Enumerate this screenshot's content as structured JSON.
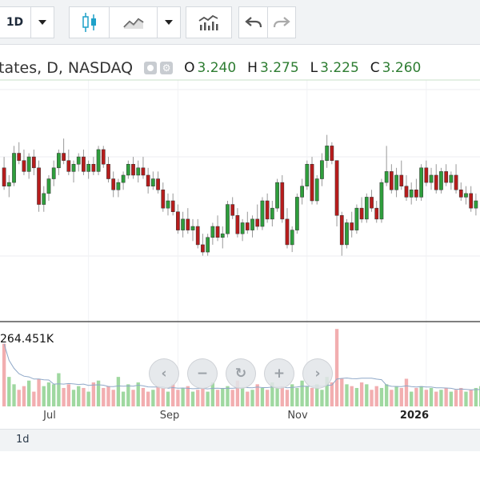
{
  "toolbar": {
    "interval_label": "1D",
    "icons": [
      "dropdown-arrow-icon",
      "candlestick-icon",
      "line-chart-icon",
      "dropdown-arrow-icon",
      "indicators-icon",
      "undo-icon",
      "redo-icon"
    ]
  },
  "legend": {
    "title": "tates, D, NASDAQ",
    "open_label": "O",
    "open": "3.240",
    "high_label": "H",
    "high": "3.275",
    "low_label": "L",
    "low": "3.225",
    "close_label": "C",
    "close": "3.260"
  },
  "volume": {
    "label": "264.451K"
  },
  "x_axis": {
    "labels": [
      {
        "text": "Jul",
        "bold": false
      },
      {
        "text": "Sep",
        "bold": false
      },
      {
        "text": "Nov",
        "bold": false
      },
      {
        "text": "2026",
        "bold": true
      }
    ]
  },
  "bottom": {
    "period": "1d"
  },
  "nav": {
    "icons": [
      "scroll-left-icon",
      "zoom-out-icon",
      "reset-icon",
      "zoom-in-icon",
      "scroll-right-icon"
    ],
    "glyphs": [
      "‹",
      "−",
      "↻",
      "+",
      "›"
    ]
  },
  "colors": {
    "up": "#2e9e3c",
    "down": "#b71c1c",
    "vol_up": "#9fd8a0",
    "vol_down": "#f2aeb0",
    "ma": "#8fa8c8"
  },
  "chart_data": {
    "type": "candlestick",
    "candles": [
      [
        3.24,
        3.27,
        3.18,
        3.19
      ],
      [
        3.19,
        3.22,
        3.16,
        3.2
      ],
      [
        3.2,
        3.3,
        3.19,
        3.28
      ],
      [
        3.28,
        3.31,
        3.25,
        3.26
      ],
      [
        3.26,
        3.29,
        3.22,
        3.23
      ],
      [
        3.23,
        3.28,
        3.21,
        3.27
      ],
      [
        3.27,
        3.29,
        3.22,
        3.24
      ],
      [
        3.24,
        3.26,
        3.12,
        3.14
      ],
      [
        3.14,
        3.19,
        3.12,
        3.17
      ],
      [
        3.17,
        3.22,
        3.15,
        3.21
      ],
      [
        3.21,
        3.26,
        3.19,
        3.24
      ],
      [
        3.24,
        3.29,
        3.22,
        3.28
      ],
      [
        3.28,
        3.32,
        3.25,
        3.26
      ],
      [
        3.26,
        3.29,
        3.22,
        3.23
      ],
      [
        3.23,
        3.26,
        3.2,
        3.25
      ],
      [
        3.25,
        3.28,
        3.23,
        3.27
      ],
      [
        3.27,
        3.29,
        3.22,
        3.23
      ],
      [
        3.23,
        3.26,
        3.21,
        3.25
      ],
      [
        3.25,
        3.27,
        3.22,
        3.23
      ],
      [
        3.23,
        3.3,
        3.22,
        3.29
      ],
      [
        3.29,
        3.3,
        3.24,
        3.25
      ],
      [
        3.25,
        3.27,
        3.2,
        3.21
      ],
      [
        3.21,
        3.23,
        3.16,
        3.18
      ],
      [
        3.18,
        3.21,
        3.16,
        3.2
      ],
      [
        3.2,
        3.23,
        3.18,
        3.22
      ],
      [
        3.22,
        3.26,
        3.21,
        3.25
      ],
      [
        3.25,
        3.27,
        3.21,
        3.22
      ],
      [
        3.22,
        3.26,
        3.2,
        3.24
      ],
      [
        3.24,
        3.27,
        3.21,
        3.22
      ],
      [
        3.22,
        3.24,
        3.17,
        3.19
      ],
      [
        3.19,
        3.23,
        3.18,
        3.21
      ],
      [
        3.21,
        3.23,
        3.17,
        3.18
      ],
      [
        3.18,
        3.2,
        3.12,
        3.13
      ],
      [
        3.13,
        3.17,
        3.11,
        3.15
      ],
      [
        3.15,
        3.17,
        3.11,
        3.12
      ],
      [
        3.12,
        3.14,
        3.06,
        3.07
      ],
      [
        3.07,
        3.12,
        3.05,
        3.1
      ],
      [
        3.1,
        3.13,
        3.06,
        3.07
      ],
      [
        3.07,
        3.1,
        3.04,
        3.08
      ],
      [
        3.08,
        3.1,
        3.02,
        3.03
      ],
      [
        3.03,
        3.06,
        3.0,
        3.01
      ],
      [
        3.01,
        3.06,
        3.0,
        3.05
      ],
      [
        3.05,
        3.09,
        3.03,
        3.08
      ],
      [
        3.08,
        3.11,
        3.04,
        3.05
      ],
      [
        3.05,
        3.08,
        3.02,
        3.06
      ],
      [
        3.06,
        3.15,
        3.05,
        3.14
      ],
      [
        3.14,
        3.16,
        3.1,
        3.11
      ],
      [
        3.11,
        3.13,
        3.05,
        3.06
      ],
      [
        3.06,
        3.1,
        3.04,
        3.09
      ],
      [
        3.09,
        3.12,
        3.06,
        3.07
      ],
      [
        3.07,
        3.11,
        3.05,
        3.1
      ],
      [
        3.1,
        3.14,
        3.07,
        3.08
      ],
      [
        3.08,
        3.16,
        3.07,
        3.15
      ],
      [
        3.15,
        3.17,
        3.09,
        3.1
      ],
      [
        3.1,
        3.15,
        3.08,
        3.13
      ],
      [
        3.13,
        3.21,
        3.12,
        3.2
      ],
      [
        3.2,
        3.22,
        3.09,
        3.1
      ],
      [
        3.1,
        3.13,
        3.02,
        3.03
      ],
      [
        3.03,
        3.08,
        3.01,
        3.07
      ],
      [
        3.07,
        3.17,
        3.06,
        3.16
      ],
      [
        3.16,
        3.21,
        3.14,
        3.19
      ],
      [
        3.19,
        3.26,
        3.18,
        3.25
      ],
      [
        3.25,
        3.27,
        3.14,
        3.15
      ],
      [
        3.15,
        3.22,
        3.14,
        3.21
      ],
      [
        3.21,
        3.28,
        3.19,
        3.26
      ],
      [
        3.26,
        3.33,
        3.24,
        3.3
      ],
      [
        3.3,
        3.31,
        3.25,
        3.26
      ],
      [
        3.26,
        3.2,
        3.08,
        3.11
      ],
      [
        3.11,
        3.12,
        3.0,
        3.03
      ],
      [
        3.03,
        3.1,
        3.02,
        3.09
      ],
      [
        3.09,
        3.12,
        3.05,
        3.07
      ],
      [
        3.07,
        3.14,
        3.06,
        3.13
      ],
      [
        3.13,
        3.16,
        3.09,
        3.1
      ],
      [
        3.1,
        3.17,
        3.09,
        3.16
      ],
      [
        3.16,
        3.18,
        3.12,
        3.13
      ],
      [
        3.13,
        3.15,
        3.09,
        3.1
      ],
      [
        3.1,
        3.21,
        3.09,
        3.2
      ],
      [
        3.2,
        3.3,
        3.19,
        3.23
      ],
      [
        3.23,
        3.25,
        3.17,
        3.18
      ],
      [
        3.18,
        3.24,
        3.16,
        3.22
      ],
      [
        3.22,
        3.26,
        3.18,
        3.19
      ],
      [
        3.19,
        3.22,
        3.15,
        3.16
      ],
      [
        3.16,
        3.2,
        3.14,
        3.18
      ],
      [
        3.18,
        3.21,
        3.15,
        3.16
      ],
      [
        3.16,
        3.25,
        3.15,
        3.24
      ],
      [
        3.24,
        3.26,
        3.19,
        3.2
      ],
      [
        3.2,
        3.24,
        3.18,
        3.22
      ],
      [
        3.22,
        3.25,
        3.17,
        3.18
      ],
      [
        3.18,
        3.24,
        3.17,
        3.23
      ],
      [
        3.23,
        3.25,
        3.19,
        3.2
      ],
      [
        3.2,
        3.23,
        3.18,
        3.22
      ],
      [
        3.22,
        3.25,
        3.17,
        3.18
      ],
      [
        3.18,
        3.2,
        3.15,
        3.16
      ],
      [
        3.16,
        3.19,
        3.14,
        3.17
      ],
      [
        3.17,
        3.19,
        3.12,
        3.13
      ],
      [
        3.13,
        3.17,
        3.11,
        3.15
      ]
    ],
    "volumes": [
      3.4,
      1.6,
      1.2,
      0.9,
      1.1,
      1.4,
      0.8,
      1.5,
      1.1,
      1.3,
      1.2,
      1.8,
      1.0,
      1.2,
      0.9,
      1.1,
      1.0,
      0.8,
      1.3,
      1.4,
      1.0,
      1.1,
      0.9,
      1.6,
      0.8,
      1.2,
      0.9,
      1.3,
      1.0,
      0.8,
      0.9,
      1.1,
      1.0,
      0.8,
      1.2,
      0.9,
      1.0,
      1.1,
      0.8,
      0.9,
      1.0,
      0.8,
      1.3,
      0.9,
      1.0,
      1.1,
      0.9,
      1.4,
      1.0,
      0.8,
      0.9,
      1.2,
      1.0,
      0.9,
      1.3,
      1.0,
      1.1,
      0.9,
      1.2,
      1.0,
      1.4,
      1.1,
      1.0,
      1.2,
      0.9,
      1.6,
      1.3,
      4.2,
      1.5,
      1.2,
      1.1,
      1.0,
      1.3,
      1.2,
      0.9,
      1.1,
      1.0,
      1.2,
      0.9,
      1.1,
      1.0,
      1.5,
      0.8,
      1.0,
      1.1,
      0.9,
      1.0,
      0.8,
      0.9,
      1.0,
      0.8,
      0.9,
      1.0,
      0.8,
      0.9,
      1.0,
      1.1
    ],
    "ma_volume": 1.1,
    "ylim": [
      2.82,
      3.48
    ],
    "vol_ylim": [
      0,
      4.6
    ],
    "x_ticks": [
      {
        "label": "Jul",
        "index": 17
      },
      {
        "label": "Sep",
        "index": 35
      },
      {
        "label": "Nov",
        "index": 61
      },
      {
        "label": "2026",
        "index": 85
      }
    ],
    "grid": true
  }
}
